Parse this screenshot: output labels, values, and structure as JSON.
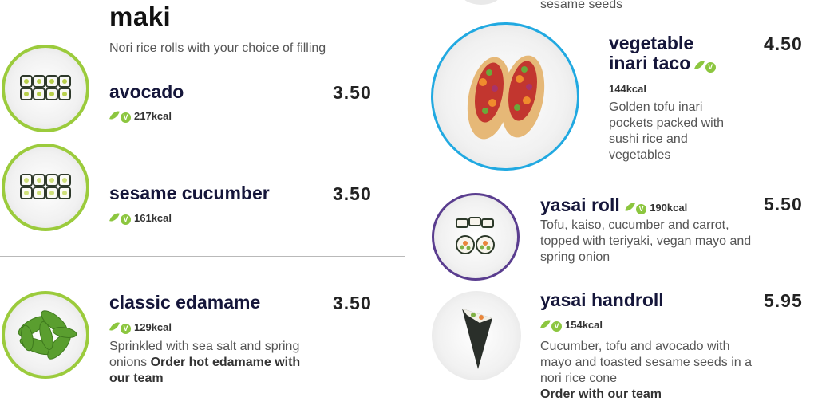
{
  "colors": {
    "accent_green": "#8cc63f",
    "ring_green": "#9bcb3c",
    "ring_blue": "#21a9e1",
    "ring_purple": "#5a3d8f"
  },
  "icons": [
    "leaf-icon",
    "vegan-v-icon"
  ],
  "maki": {
    "title": "maki",
    "description": "Nori rice rolls with your choice of filling",
    "items": [
      {
        "name": "avocado",
        "price": "3.50",
        "kcal": "217kcal",
        "veg_badge": "V"
      },
      {
        "name": "sesame cucumber",
        "price": "3.50",
        "kcal": "161kcal",
        "veg_badge": "V"
      }
    ]
  },
  "edamame": {
    "name": "classic edamame",
    "price": "3.50",
    "kcal": "129kcal",
    "veg_badge": "V",
    "desc": "Sprinkled with sea salt and spring onions",
    "note": "Order hot edamame with our team"
  },
  "top_fragment": "sesame seeds",
  "inari": {
    "name_line1": "vegetable",
    "name_line2": "inari taco",
    "veg_badge": "V",
    "price": "4.50",
    "kcal": "144kcal",
    "desc": "Golden tofu inari pockets packed with sushi rice and vegetables"
  },
  "yasai_roll": {
    "name": "yasai roll",
    "veg_badge": "V",
    "kcal": "190kcal",
    "price": "5.50",
    "desc": "Tofu, kaiso, cucumber and carrot, topped with teriyaki, vegan mayo and spring onion"
  },
  "handroll": {
    "name": "yasai handroll",
    "price": "5.95",
    "kcal": "154kcal",
    "veg_badge": "V",
    "desc": "Cucumber, tofu and avocado with mayo and toasted sesame seeds in a nori rice cone",
    "note": "Order with our team"
  }
}
